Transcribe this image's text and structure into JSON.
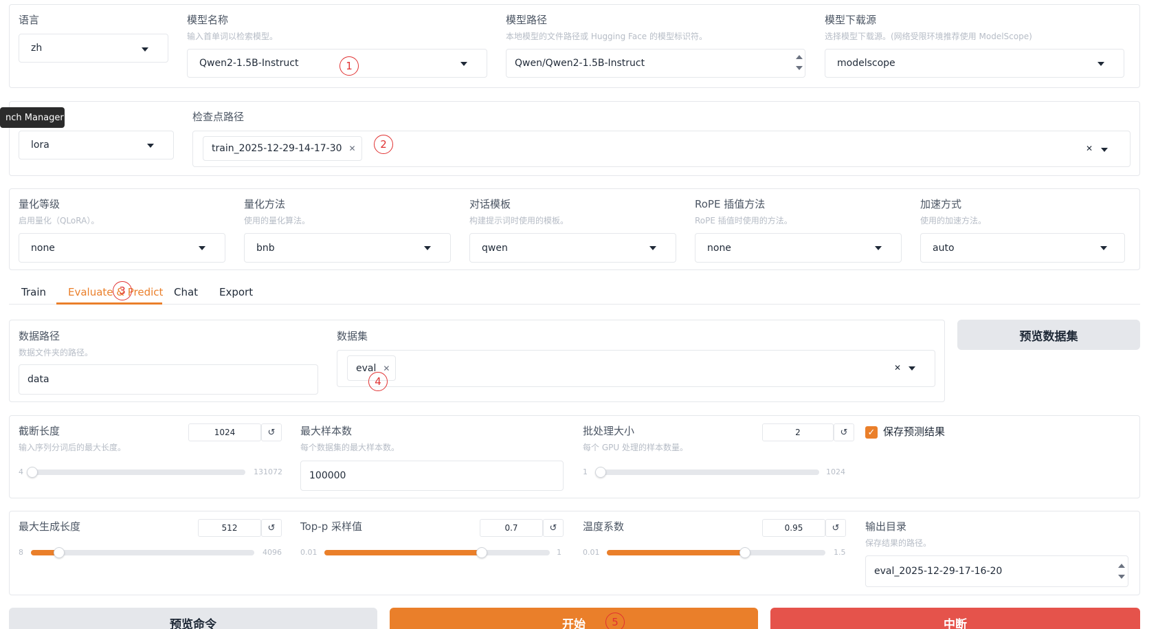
{
  "top": {
    "language": {
      "label": "语言",
      "value": "zh"
    },
    "model_name": {
      "label": "模型名称",
      "hint": "输入首单词以检索模型。",
      "value": "Qwen2-1.5B-Instruct"
    },
    "model_path": {
      "label": "模型路径",
      "hint": "本地模型的文件路径或 Hugging Face 的模型标识符。",
      "value": "Qwen/Qwen2-1.5B-Instruct"
    },
    "model_source": {
      "label": "模型下载源",
      "hint": "选择模型下载源。(网络受限环境推荐使用 ModelScope)",
      "value": "modelscope"
    }
  },
  "finetune": {
    "tooltip": "nch Manager",
    "method_value": "lora",
    "checkpoint": {
      "label": "检查点路径",
      "chip": "train_2025-12-29-14-17-30"
    }
  },
  "advanced": {
    "quant_bit": {
      "label": "量化等级",
      "hint": "启用量化（QLoRA）。",
      "value": "none"
    },
    "quant_method": {
      "label": "量化方法",
      "hint": "使用的量化算法。",
      "value": "bnb"
    },
    "template": {
      "label": "对话模板",
      "hint": "构建提示词时使用的模板。",
      "value": "qwen"
    },
    "rope": {
      "label": "RoPE 插值方法",
      "hint": "RoPE 插值时使用的方法。",
      "value": "none"
    },
    "booster": {
      "label": "加速方式",
      "hint": "使用的加速方法。",
      "value": "auto"
    }
  },
  "tabs": [
    "Train",
    "Evaluate & Predict",
    "Chat",
    "Export"
  ],
  "active_tab": 1,
  "eval": {
    "dataset_dir": {
      "label": "数据路径",
      "hint": "数据文件夹的路径。",
      "value": "data"
    },
    "dataset": {
      "label": "数据集",
      "chip": "eval"
    },
    "preview_dataset": "预览数据集",
    "cutoff_len": {
      "label": "截断长度",
      "hint": "输入序列分词后的最大长度。",
      "value": "1024",
      "min": "4",
      "max": "131072",
      "fraction": 0.008
    },
    "max_samples": {
      "label": "最大样本数",
      "hint": "每个数据集的最大样本数。",
      "value": "100000"
    },
    "batch_size": {
      "label": "批处理大小",
      "hint": "每个 GPU 处理的样本数量。",
      "value": "2",
      "min": "1",
      "max": "1024",
      "fraction": 0.001
    },
    "predict": {
      "label": "保存预测结果",
      "checked": true
    },
    "max_new_tokens": {
      "label": "最大生成长度",
      "value": "512",
      "min": "8",
      "max": "4096",
      "fraction": 0.125
    },
    "top_p": {
      "label": "Top-p 采样值",
      "value": "0.7",
      "min": "0.01",
      "max": "1",
      "fraction": 0.697
    },
    "temperature": {
      "label": "温度系数",
      "value": "0.95",
      "min": "0.01",
      "max": "1.5",
      "fraction": 0.631
    },
    "output_dir": {
      "label": "输出目录",
      "hint": "保存结果的路径。",
      "value": "eval_2025-12-29-17-16-20"
    }
  },
  "buttons": {
    "preview_cmd": "预览命令",
    "start": "开始",
    "abort": "中断"
  },
  "markers": [
    "1",
    "2",
    "3",
    "4",
    "5"
  ],
  "colors": {
    "accent": "#ea7f2a",
    "danger": "#e5534b",
    "marker": "#e03131",
    "neutral_button": "#e5e7eb"
  },
  "icons": {
    "reset": "reset-icon",
    "dropdown": "chevron-down-icon",
    "remove": "close-icon",
    "check": "check-icon"
  }
}
